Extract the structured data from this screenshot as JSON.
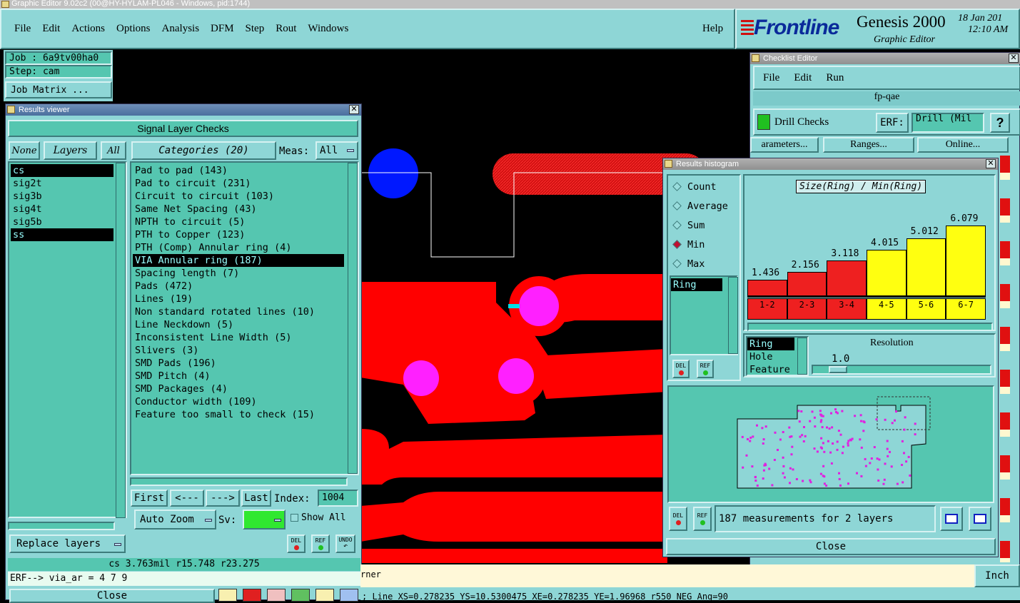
{
  "titlebar": "Graphic Editor 9.02c2 (00@HY-HYLAM-PL046 - Windows, pid:1744)",
  "menu": [
    "File",
    "Edit",
    "Actions",
    "Options",
    "Analysis",
    "DFM",
    "Step",
    "Rout",
    "Windows"
  ],
  "help": "Help",
  "brand": {
    "logo": "Frontline",
    "product": "Genesis 2000",
    "subtitle": "Graphic Editor",
    "date": "18 Jan 201",
    "time": "12:10 AM"
  },
  "job": {
    "job": "Job : 6a9tv00ha0",
    "step": "Step: cam",
    "matrix": "Job Matrix ..."
  },
  "results_viewer": {
    "title": "Results viewer",
    "header": "Signal Layer Checks",
    "none": "None",
    "layers": "Layers",
    "all": "All",
    "categories": "Categories (20)",
    "meas_label": "Meas:",
    "meas_value": "All",
    "layer_list": [
      {
        "name": "cs",
        "sel": true
      },
      {
        "name": "sig2t",
        "sel": false
      },
      {
        "name": "sig3b",
        "sel": false
      },
      {
        "name": "sig4t",
        "sel": false
      },
      {
        "name": "sig5b",
        "sel": false
      },
      {
        "name": "ss",
        "sel": true
      }
    ],
    "category_list": [
      {
        "name": "Pad to pad (143)",
        "sel": false
      },
      {
        "name": "Pad to circuit (231)",
        "sel": false
      },
      {
        "name": "Circuit to circuit (103)",
        "sel": false
      },
      {
        "name": "Same Net Spacing (43)",
        "sel": false
      },
      {
        "name": "NPTH to circuit (5)",
        "sel": false
      },
      {
        "name": "PTH to Copper (123)",
        "sel": false
      },
      {
        "name": "PTH (Comp) Annular ring (4)",
        "sel": false
      },
      {
        "name": "VIA Annular ring (187)",
        "sel": true
      },
      {
        "name": "Spacing length (7)",
        "sel": false
      },
      {
        "name": "Pads (472)",
        "sel": false
      },
      {
        "name": "Lines (19)",
        "sel": false
      },
      {
        "name": "Non standard rotated lines (10)",
        "sel": false
      },
      {
        "name": "Line Neckdown (5)",
        "sel": false
      },
      {
        "name": "Inconsistent Line Width (5)",
        "sel": false
      },
      {
        "name": "Slivers (3)",
        "sel": false
      },
      {
        "name": "SMD Pads (196)",
        "sel": false
      },
      {
        "name": "SMD Pitch (4)",
        "sel": false
      },
      {
        "name": "SMD Packages (4)",
        "sel": false
      },
      {
        "name": "Conductor width (109)",
        "sel": false
      },
      {
        "name": "Feature too small to check (15)",
        "sel": false
      }
    ],
    "first": "First",
    "prev": "<---",
    "next": "--->",
    "last": "Last",
    "index_label": "Index:",
    "index_value": "1004",
    "auto_zoom": "Auto Zoom",
    "sv": "Sv:",
    "show_all": "Show All",
    "replace_layers": "Replace layers",
    "del": "DEL",
    "ref": "REF",
    "undo": "UNDO",
    "status": "cs 3.763mil  r15.748  r23.275",
    "erf": "ERF--> via_ar = 4 7 9",
    "close": "Close"
  },
  "checklist": {
    "title": "Checklist Editor",
    "menu": [
      "File",
      "Edit",
      "Run"
    ],
    "name": "fp-qae",
    "drill_checks": "Drill Checks",
    "erf": "ERF:",
    "erf_value": "Drill (Mil",
    "help": "?",
    "parameters": "arameters...",
    "ranges": "Ranges...",
    "online": "Online..."
  },
  "histogram": {
    "title": "Results histogram",
    "options": [
      {
        "label": "Count",
        "on": false
      },
      {
        "label": "Average",
        "on": false
      },
      {
        "label": "Sum",
        "on": false
      },
      {
        "label": "Min",
        "on": true
      },
      {
        "label": "Max",
        "on": false
      }
    ],
    "chart_title": "Size(Ring) / Min(Ring)",
    "ring_list": [
      "Ring"
    ],
    "bars": [
      {
        "value": "1.436",
        "range": "1-2",
        "color": "#ee2020"
      },
      {
        "value": "2.156",
        "range": "2-3",
        "color": "#ee2020"
      },
      {
        "value": "3.118",
        "range": "3-4",
        "color": "#ee2020"
      },
      {
        "value": "4.015",
        "range": "4-5",
        "color": "#ffff10"
      },
      {
        "value": "5.012",
        "range": "5-6",
        "color": "#ffff10"
      },
      {
        "value": "6.079",
        "range": "6-7",
        "color": "#ffff10"
      }
    ],
    "types": [
      {
        "label": "Ring",
        "sel": true
      },
      {
        "label": "Hole",
        "sel": false
      },
      {
        "label": "Feature",
        "sel": false
      }
    ],
    "resolution_label": "Resolution",
    "resolution_value": "1.0",
    "del": "DEL",
    "ref": "REF",
    "measurements": "187 measurements for 2 layers",
    "close": "Close"
  },
  "bottom": {
    "prompt": "rner",
    "units": "Inch",
    "coords": "; Line XS=0.278235 YS=10.5300475 XE=0.278235 YE=1.96968 r550 NEG Ang=90"
  },
  "colors": {
    "panel": "#8ed6d6",
    "field": "#55c6b0",
    "copper": "#ff0000",
    "pad": "#ff20ff",
    "via": "#0018ff"
  }
}
